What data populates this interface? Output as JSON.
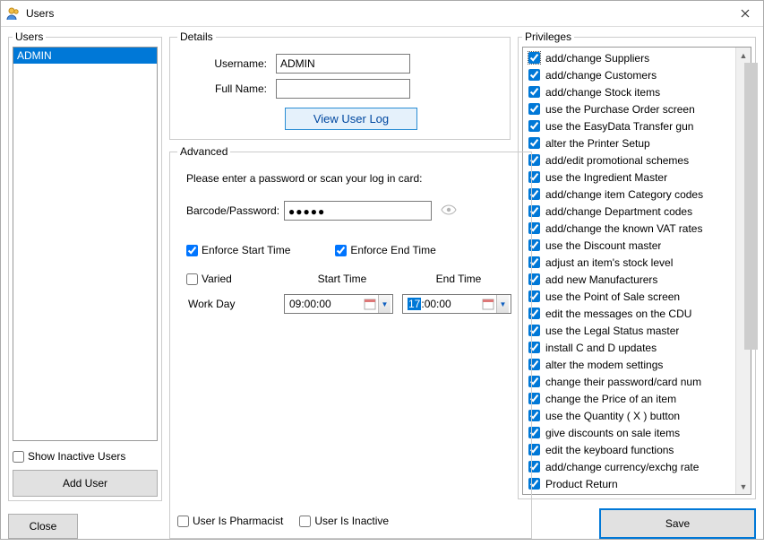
{
  "window": {
    "title": "Users"
  },
  "users_panel": {
    "legend": "Users",
    "items": [
      "ADMIN"
    ],
    "selected_index": 0,
    "show_inactive_label": "Show Inactive Users",
    "show_inactive_checked": false,
    "add_user_label": "Add User",
    "close_label": "Close"
  },
  "details": {
    "legend": "Details",
    "username_label": "Username:",
    "username_value": "ADMIN",
    "fullname_label": "Full Name:",
    "fullname_value": "",
    "view_log_label": "View User Log"
  },
  "advanced": {
    "legend": "Advanced",
    "hint": "Please enter a password or scan your log in card:",
    "barcode_label": "Barcode/Password:",
    "barcode_value_masked": "●●●●●",
    "enforce_start_label": "Enforce Start Time",
    "enforce_start_checked": true,
    "enforce_end_label": "Enforce End Time",
    "enforce_end_checked": true,
    "varied_label": "Varied",
    "varied_checked": false,
    "start_time_header": "Start Time",
    "end_time_header": "End Time",
    "work_day_label": "Work Day",
    "start_time_value": "09:00:00",
    "end_time_hh": "17",
    "end_time_rest": ":00:00",
    "user_is_pharmacist_label": "User Is Pharmacist",
    "user_is_pharmacist_checked": false,
    "user_is_inactive_label": "User Is Inactive",
    "user_is_inactive_checked": false
  },
  "privileges": {
    "legend": "Privileges",
    "items": [
      {
        "label": "add/change Suppliers",
        "checked": true,
        "highlight": true
      },
      {
        "label": "add/change Customers",
        "checked": true
      },
      {
        "label": "add/change Stock items",
        "checked": true
      },
      {
        "label": "use the Purchase Order screen",
        "checked": true
      },
      {
        "label": "use the EasyData Transfer gun",
        "checked": true
      },
      {
        "label": "alter the Printer Setup",
        "checked": true
      },
      {
        "label": "add/edit promotional schemes",
        "checked": true
      },
      {
        "label": "use the Ingredient Master",
        "checked": true
      },
      {
        "label": "add/change item Category codes",
        "checked": true
      },
      {
        "label": "add/change Department codes",
        "checked": true
      },
      {
        "label": "add/change the known VAT rates",
        "checked": true
      },
      {
        "label": "use the Discount master",
        "checked": true
      },
      {
        "label": "adjust an item's stock level",
        "checked": true
      },
      {
        "label": "add new Manufacturers",
        "checked": true
      },
      {
        "label": "use the Point of Sale screen",
        "checked": true
      },
      {
        "label": "edit the messages on the CDU",
        "checked": true
      },
      {
        "label": "use the Legal Status master",
        "checked": true
      },
      {
        "label": "install C and D updates",
        "checked": true
      },
      {
        "label": "alter the modem settings",
        "checked": true
      },
      {
        "label": "change their password/card num",
        "checked": true
      },
      {
        "label": "change the Price of an item",
        "checked": true
      },
      {
        "label": "use the Quantity ( X ) button",
        "checked": true
      },
      {
        "label": "give discounts on sale items",
        "checked": true
      },
      {
        "label": "edit the keyboard functions",
        "checked": true
      },
      {
        "label": "add/change currency/exchg rate",
        "checked": true
      },
      {
        "label": "Product Return",
        "checked": true
      }
    ],
    "save_label": "Save"
  }
}
